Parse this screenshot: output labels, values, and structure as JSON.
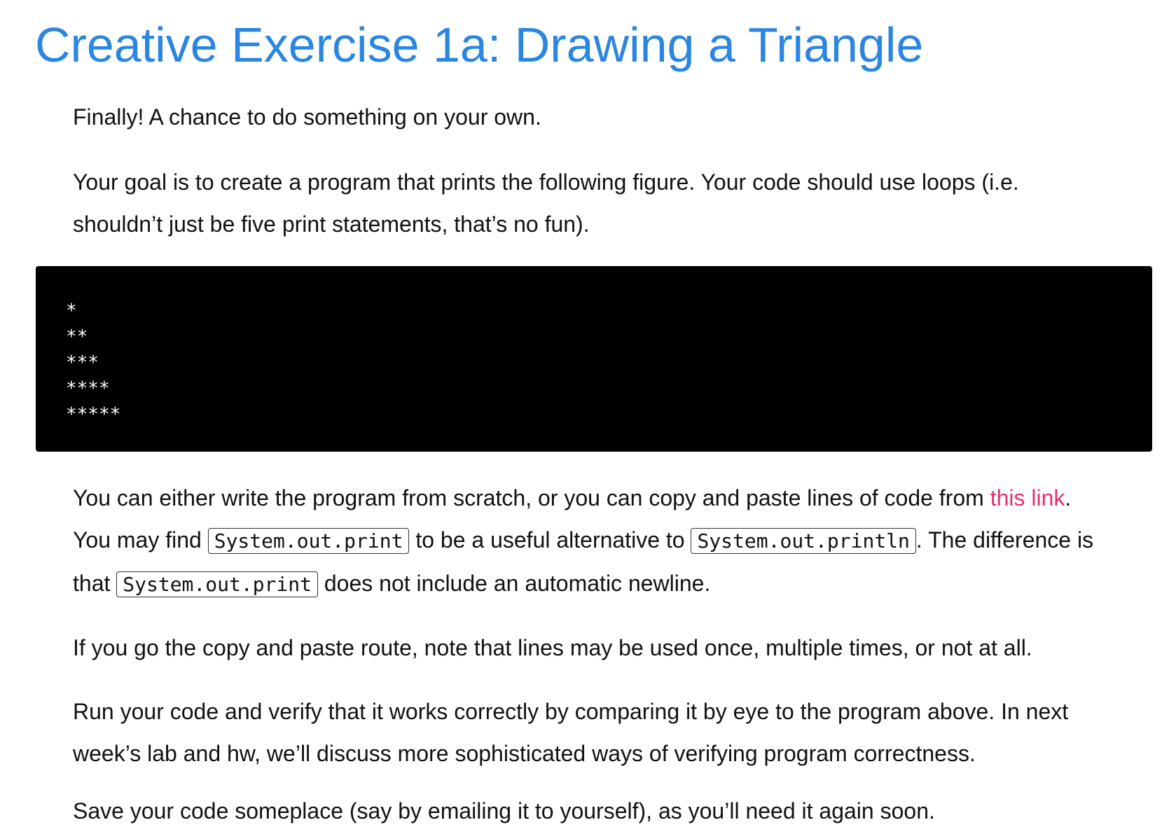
{
  "title": "Creative Exercise 1a: Drawing a Triangle",
  "intro": "Finally! A chance to do something on your own.",
  "goal": "Your goal is to create a program that prints the following figure. Your code should use loops (i.e. shouldn’t just be five print statements, that’s no fun).",
  "code_block": {
    "lines": [
      "*",
      "**",
      "***",
      "****",
      "*****"
    ]
  },
  "instructions": {
    "part1": "You can either write the program from scratch, or you can copy and paste lines of code from ",
    "link_text": "this link",
    "part2": ". You may find ",
    "code1": "System.out.print",
    "part3": " to be a useful alternative to ",
    "code2": "System.out.println",
    "part4": ". The difference is that ",
    "code3": "System.out.print",
    "part5": " does not include an automatic newline."
  },
  "copy_paste_note": "If you go the copy and paste route, note that lines may be used once, multiple times, or not at all.",
  "verify": "Run your code and verify that it works correctly by comparing it by eye to the program above. In next week’s lab and hw, we’ll discuss more sophisticated ways of verifying program correctness.",
  "save": "Save your code someplace (say by emailing it to yourself), as you’ll need it again soon.",
  "colors": {
    "title": "#2a86e0",
    "link": "#e0336a",
    "code_background": "#000000",
    "code_text": "#ffffff"
  }
}
